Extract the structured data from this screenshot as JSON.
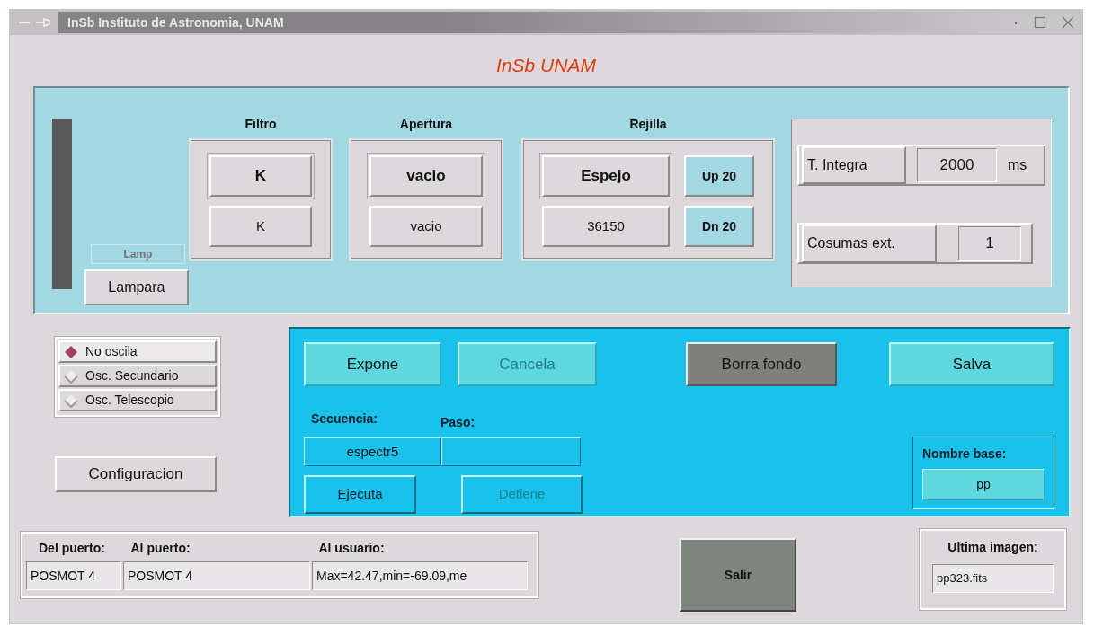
{
  "window": {
    "title": "InSb Instituto de Astronomia, UNAM"
  },
  "heading": "InSb UNAM",
  "lamp": {
    "label": "Lamp",
    "label_disabled": true,
    "button": "Lampara"
  },
  "mechanisms": [
    {
      "title": "Filtro",
      "button": "K",
      "value": "K"
    },
    {
      "title": "Apertura",
      "button": "vacio",
      "value": "vacio"
    },
    {
      "title": "Rejilla",
      "button": "Espejo",
      "value": "36150",
      "steps": [
        "Up 20",
        "Dn 20"
      ]
    }
  ],
  "integration": {
    "button": "T. Integra",
    "value": "2000",
    "unit": "ms"
  },
  "coadds": {
    "button": "Cosumas ext.",
    "value": "1"
  },
  "oscillation": [
    {
      "label": "No oscila",
      "selected": true
    },
    {
      "label": "Osc. Secundario",
      "selected": false
    },
    {
      "label": "Osc. Telescopio",
      "selected": false
    }
  ],
  "config_button": "Configuracion",
  "actions": [
    {
      "label": "Expone",
      "kind": "light",
      "disabled": false
    },
    {
      "label": "Cancela",
      "kind": "light",
      "disabled": true
    },
    {
      "label": "Borra fondo",
      "kind": "dark",
      "disabled": false
    },
    {
      "label": "Salva",
      "kind": "light",
      "disabled": false
    }
  ],
  "sequence": {
    "label": "Secuencia:",
    "value": "espectr5",
    "step_label": "Paso:"
  },
  "run_buttons": [
    {
      "label": "Ejecuta",
      "disabled": false
    },
    {
      "label": "Detiene",
      "disabled": true
    }
  ],
  "base_name": {
    "label": "Nombre base:",
    "value": "pp"
  },
  "status": [
    {
      "label": "Del puerto:",
      "value": "POSMOT 4"
    },
    {
      "label": "Al puerto:",
      "value": "POSMOT 4"
    },
    {
      "label": "Al usuario:",
      "value": "Max=42.47,min=-69.09,me"
    }
  ],
  "exit_button": {
    "label": "Salir",
    "kind": "dark"
  },
  "last_image": {
    "label": "Ultima imagen:",
    "value": "pp323.fits"
  }
}
